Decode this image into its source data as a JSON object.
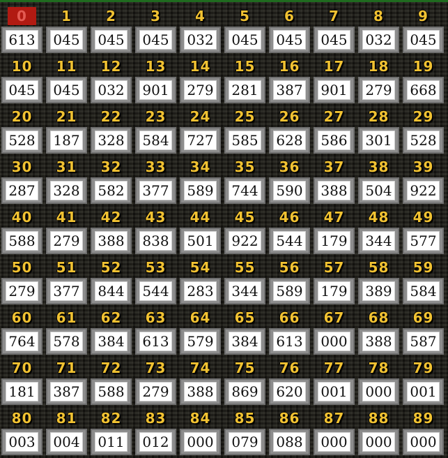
{
  "board": {
    "highlight_color": "#b11a12",
    "number_color": "#f1c232",
    "cells": [
      {
        "n": "0",
        "v": "613",
        "hl": true
      },
      {
        "n": "1",
        "v": "045"
      },
      {
        "n": "2",
        "v": "045"
      },
      {
        "n": "3",
        "v": "045"
      },
      {
        "n": "4",
        "v": "032"
      },
      {
        "n": "5",
        "v": "045"
      },
      {
        "n": "6",
        "v": "045"
      },
      {
        "n": "7",
        "v": "045"
      },
      {
        "n": "8",
        "v": "032"
      },
      {
        "n": "9",
        "v": "045"
      },
      {
        "n": "10",
        "v": "045"
      },
      {
        "n": "11",
        "v": "045"
      },
      {
        "n": "12",
        "v": "032"
      },
      {
        "n": "13",
        "v": "901"
      },
      {
        "n": "14",
        "v": "279"
      },
      {
        "n": "15",
        "v": "281"
      },
      {
        "n": "16",
        "v": "387"
      },
      {
        "n": "17",
        "v": "901"
      },
      {
        "n": "18",
        "v": "279"
      },
      {
        "n": "19",
        "v": "668"
      },
      {
        "n": "20",
        "v": "528"
      },
      {
        "n": "21",
        "v": "187"
      },
      {
        "n": "22",
        "v": "328"
      },
      {
        "n": "23",
        "v": "584"
      },
      {
        "n": "24",
        "v": "727"
      },
      {
        "n": "25",
        "v": "585"
      },
      {
        "n": "26",
        "v": "628"
      },
      {
        "n": "27",
        "v": "586"
      },
      {
        "n": "28",
        "v": "301"
      },
      {
        "n": "29",
        "v": "528"
      },
      {
        "n": "30",
        "v": "287"
      },
      {
        "n": "31",
        "v": "328"
      },
      {
        "n": "32",
        "v": "582"
      },
      {
        "n": "33",
        "v": "377"
      },
      {
        "n": "34",
        "v": "589"
      },
      {
        "n": "35",
        "v": "744"
      },
      {
        "n": "36",
        "v": "590"
      },
      {
        "n": "37",
        "v": "388"
      },
      {
        "n": "38",
        "v": "504"
      },
      {
        "n": "39",
        "v": "922"
      },
      {
        "n": "40",
        "v": "588"
      },
      {
        "n": "41",
        "v": "279"
      },
      {
        "n": "42",
        "v": "388"
      },
      {
        "n": "43",
        "v": "838"
      },
      {
        "n": "44",
        "v": "501"
      },
      {
        "n": "45",
        "v": "922"
      },
      {
        "n": "46",
        "v": "544"
      },
      {
        "n": "47",
        "v": "179"
      },
      {
        "n": "48",
        "v": "344"
      },
      {
        "n": "49",
        "v": "577"
      },
      {
        "n": "50",
        "v": "279"
      },
      {
        "n": "51",
        "v": "377"
      },
      {
        "n": "52",
        "v": "844"
      },
      {
        "n": "53",
        "v": "544"
      },
      {
        "n": "54",
        "v": "283"
      },
      {
        "n": "55",
        "v": "344"
      },
      {
        "n": "56",
        "v": "589"
      },
      {
        "n": "57",
        "v": "179"
      },
      {
        "n": "58",
        "v": "389"
      },
      {
        "n": "59",
        "v": "584"
      },
      {
        "n": "60",
        "v": "764"
      },
      {
        "n": "61",
        "v": "578"
      },
      {
        "n": "62",
        "v": "384"
      },
      {
        "n": "63",
        "v": "613"
      },
      {
        "n": "64",
        "v": "579"
      },
      {
        "n": "65",
        "v": "384"
      },
      {
        "n": "66",
        "v": "613"
      },
      {
        "n": "67",
        "v": "000"
      },
      {
        "n": "68",
        "v": "388"
      },
      {
        "n": "69",
        "v": "587"
      },
      {
        "n": "70",
        "v": "181"
      },
      {
        "n": "71",
        "v": "387"
      },
      {
        "n": "72",
        "v": "588"
      },
      {
        "n": "73",
        "v": "279"
      },
      {
        "n": "74",
        "v": "388"
      },
      {
        "n": "75",
        "v": "869"
      },
      {
        "n": "76",
        "v": "620"
      },
      {
        "n": "77",
        "v": "001"
      },
      {
        "n": "78",
        "v": "000"
      },
      {
        "n": "79",
        "v": "001"
      },
      {
        "n": "80",
        "v": "003"
      },
      {
        "n": "81",
        "v": "004"
      },
      {
        "n": "82",
        "v": "011"
      },
      {
        "n": "83",
        "v": "012"
      },
      {
        "n": "84",
        "v": "000"
      },
      {
        "n": "85",
        "v": "079"
      },
      {
        "n": "86",
        "v": "088"
      },
      {
        "n": "87",
        "v": "000"
      },
      {
        "n": "88",
        "v": "000"
      },
      {
        "n": "89",
        "v": "000"
      }
    ]
  }
}
